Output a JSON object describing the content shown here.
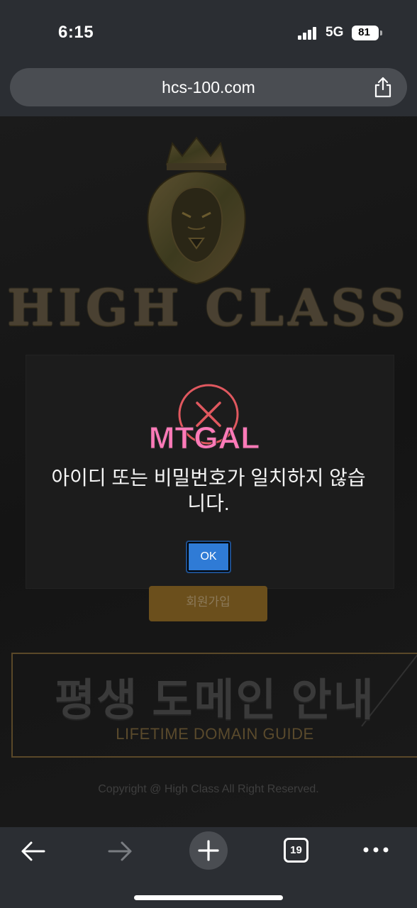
{
  "status_bar": {
    "time": "6:15",
    "network": "5G",
    "battery": "81"
  },
  "browser": {
    "url": "hcs-100.com",
    "tab_count": "19"
  },
  "site": {
    "brand_title": "HIGH CLASS",
    "signup_label": "회원가입",
    "domain_title": "평생 도메인 안내",
    "domain_subtitle": "LIFETIME DOMAIN GUIDE",
    "copyright": "Copyright @ High Class All Right Reserved."
  },
  "alert": {
    "message": "아이디 또는 비밀번호가 일치하지 않습니다.",
    "ok_label": "OK",
    "watermark": "MTGAL"
  },
  "colors": {
    "alert_button": "#2f7bd6",
    "alert_icon": "#e0585f",
    "gold": "#6b4f1c"
  },
  "icons": [
    "share-icon",
    "back-icon",
    "forward-icon",
    "plus-icon",
    "more-icon",
    "error-x-icon",
    "lion-logo"
  ]
}
